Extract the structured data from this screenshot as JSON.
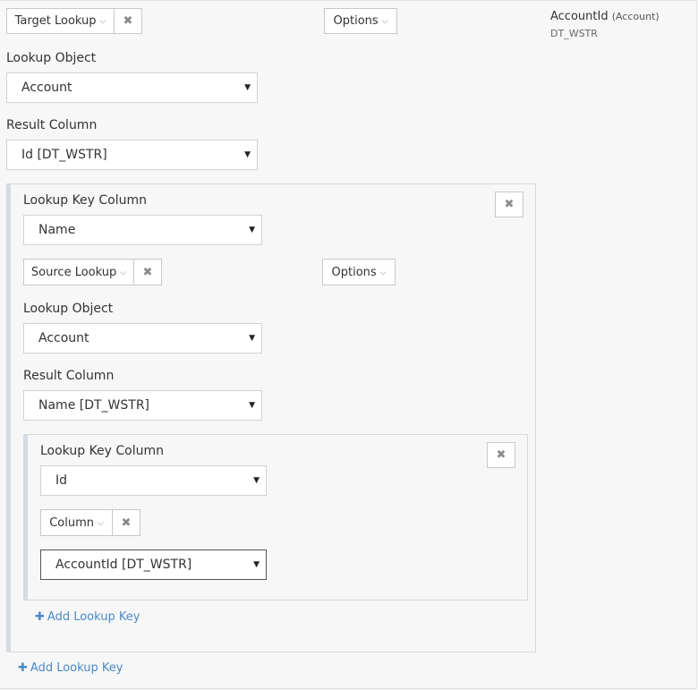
{
  "top": {
    "target_lookup_label": "Target Lookup",
    "remove_icon": "×",
    "options_label": "Options",
    "lookup_object_label": "Lookup Object",
    "lookup_object_value": "Account",
    "result_column_label": "Result Column",
    "result_column_value": "Id [DT_WSTR]",
    "add_lookup_key": "Add Lookup Key"
  },
  "side": {
    "field_name": "AccountId",
    "field_object": "(Account)",
    "field_type": "DT_WSTR"
  },
  "key1": {
    "lookup_key_column_label": "Lookup Key Column",
    "lookup_key_column_value": "Name",
    "source_lookup_label": "Source Lookup",
    "options_label": "Options",
    "lookup_object_label": "Lookup Object",
    "lookup_object_value": "Account",
    "result_column_label": "Result Column",
    "result_column_value": "Name [DT_WSTR]",
    "add_lookup_key": "Add Lookup Key"
  },
  "key2": {
    "lookup_key_column_label": "Lookup Key Column",
    "lookup_key_column_value": "Id",
    "column_label": "Column",
    "column_value": "AccountId [DT_WSTR]"
  },
  "icons": {
    "chevron": "chevron-down-icon",
    "remove": "close-icon",
    "select_arrow": "caret-down-icon",
    "plus": "plus-icon"
  },
  "colors": {
    "link": "#4a8ac9",
    "panel_accent": "#d4dbe5"
  }
}
